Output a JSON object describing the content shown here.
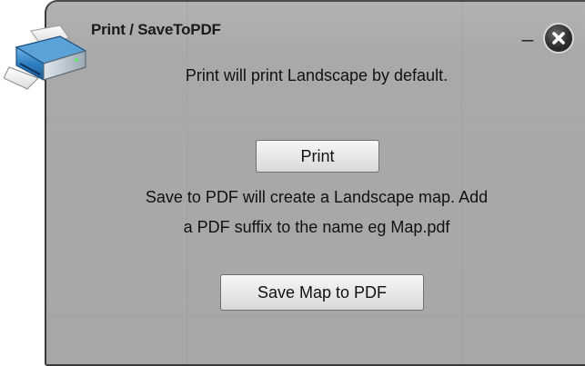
{
  "dialog": {
    "title": "Print / SaveToPDF",
    "minimize_label": "_",
    "close_icon": "close-icon"
  },
  "content": {
    "print_info": "Print will print Landscape by default.",
    "print_button": "Print",
    "pdf_info_line1": "Save to PDF will create a Landscape map. Add",
    "pdf_info_line2": "a PDF suffix to the name eg Map.pdf",
    "save_pdf_button": "Save Map to PDF"
  },
  "icons": {
    "printer": "printer-icon"
  },
  "colors": {
    "dialog_background": "#a9a9a9",
    "border": "#3a3a3a",
    "close_button": "#2e2e2e"
  }
}
